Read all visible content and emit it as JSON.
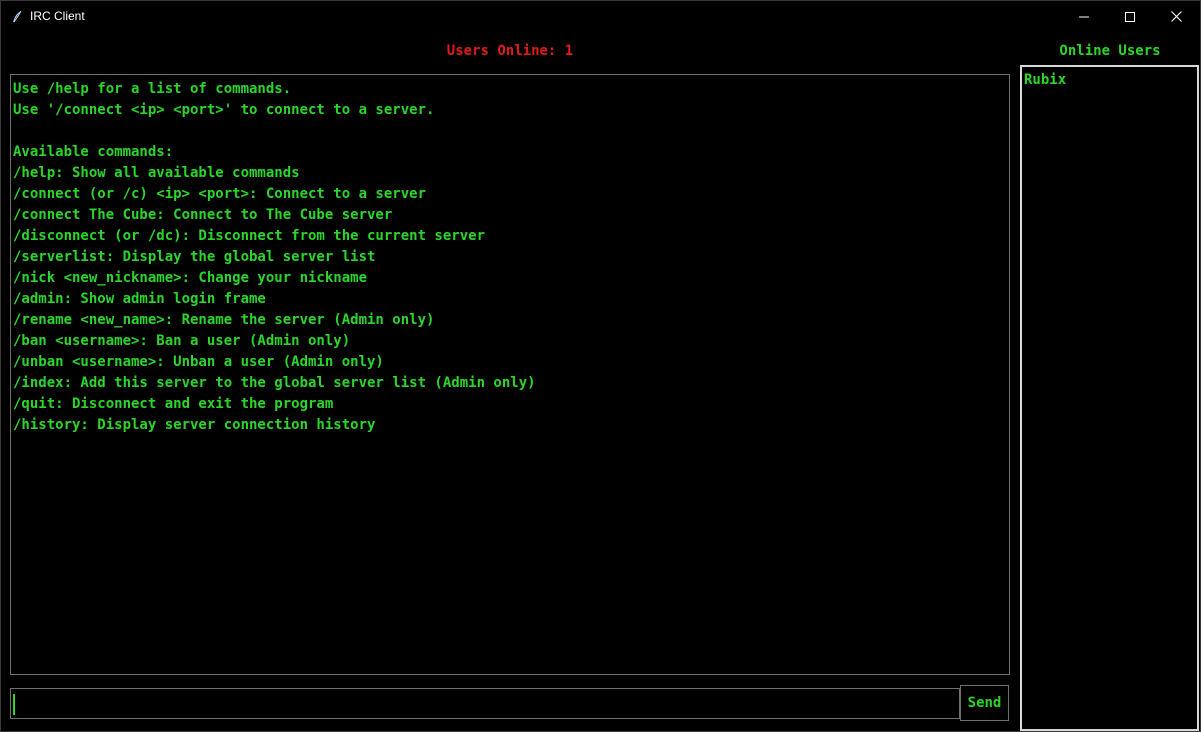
{
  "window": {
    "title": "IRC Client"
  },
  "header": {
    "users_online": "Users Online: 1",
    "online_users_title": "Online Users"
  },
  "chat_log": {
    "lines": [
      "Use /help for a list of commands.",
      "Use '/connect <ip> <port>' to connect to a server.",
      "",
      "Available commands:",
      "/help: Show all available commands",
      "/connect (or /c) <ip> <port>: Connect to a server",
      "/connect The Cube: Connect to The Cube server",
      "/disconnect (or /dc): Disconnect from the current server",
      "/serverlist: Display the global server list",
      "/nick <new_nickname>: Change your nickname",
      "/admin: Show admin login frame",
      "/rename <new_name>: Rename the server (Admin only)",
      "/ban <username>: Ban a user (Admin only)",
      "/unban <username>: Unban a user (Admin only)",
      "/index: Add this server to the global server list (Admin only)",
      "/quit: Disconnect and exit the program",
      "/history: Display server connection history"
    ]
  },
  "input": {
    "value": "",
    "send_label": "Send"
  },
  "users": {
    "items": [
      "Rubix"
    ]
  },
  "colors": {
    "text_green": "#2bd62b",
    "alert_red": "#e01b1b",
    "background": "#000000"
  }
}
